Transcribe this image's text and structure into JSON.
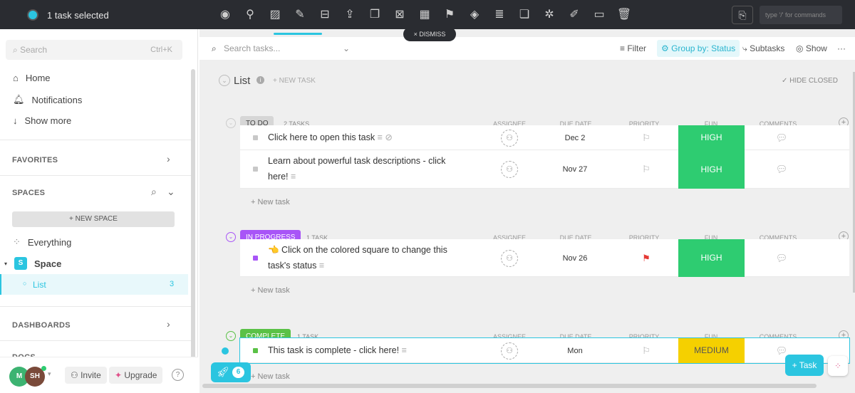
{
  "topbar": {
    "selected": "1 task selected",
    "icons": [
      "eye-icon",
      "assign-user-icon",
      "tag-icon",
      "paperclip-icon",
      "subtask-icon",
      "move-icon",
      "duplicate-icon",
      "remove-icon",
      "calendar-icon",
      "flag-icon",
      "status-icon",
      "dependency-icon",
      "copy-icon",
      "custom-field-icon",
      "edit-icon",
      "archive-icon",
      "trash-icon"
    ],
    "command_placeholder": "type '/' for commands",
    "dismiss": "× DISMISS"
  },
  "sidebar": {
    "search": "Search",
    "shortcut": "Ctrl+K",
    "nav": [
      {
        "label": "Home"
      },
      {
        "label": "Notifications"
      },
      {
        "label": "Show more"
      }
    ],
    "favorites": "FAVORITES",
    "spaces": "SPACES",
    "new_space": "+ NEW SPACE",
    "everything": "Everything",
    "space": "Space",
    "space_letter": "S",
    "list": "List",
    "list_count": "3",
    "dashboards": "DASHBOARDS",
    "docs": "DOCS",
    "avatars": [
      "M",
      "SH"
    ],
    "invite": "Invite",
    "upgrade": "Upgrade",
    "help": "?"
  },
  "toolbar": {
    "search_placeholder": "Search tasks...",
    "filter": "Filter",
    "group_by": "Group by: Status",
    "subtasks": "Subtasks",
    "show": "Show",
    "more": "···"
  },
  "list": {
    "title": "List",
    "new_task": "+ NEW TASK",
    "hide_closed": "✓ HIDE CLOSED",
    "columns": [
      "ASSIGNEE",
      "DUE DATE",
      "PRIORITY",
      "FUN",
      "COMMENTS"
    ],
    "new_task_row": "+ New task",
    "groups": [
      {
        "status": "TO DO",
        "count": "2 TASKS",
        "color": "#d6d6d6",
        "text": "#444",
        "tasks": [
          {
            "name": "Click here to open this task",
            "due": "Dec 2",
            "priority": "none",
            "fun": "HIGH",
            "fun_color": "#2ecc71"
          },
          {
            "name": "Learn about powerful task descriptions - click here!",
            "due": "Nov 27",
            "priority": "none",
            "fun": "HIGH",
            "fun_color": "#2ecc71"
          }
        ]
      },
      {
        "status": "IN PROGRESS",
        "count": "1 TASK",
        "color": "#a855f7",
        "text": "#fff",
        "tasks": [
          {
            "name": "👈 Click on the colored square to change this task's status",
            "due": "Nov 26",
            "priority": "urgent",
            "fun": "HIGH",
            "fun_color": "#2ecc71"
          }
        ]
      },
      {
        "status": "COMPLETE",
        "count": "1 TASK",
        "color": "#5ac146",
        "text": "#fff",
        "tasks": [
          {
            "name": "This task is complete - click here!",
            "due": "Mon",
            "priority": "none",
            "fun": "MEDIUM",
            "fun_color": "#f5d000"
          }
        ]
      }
    ]
  },
  "fab": {
    "rocket_count": "6",
    "task": "+ Task"
  }
}
